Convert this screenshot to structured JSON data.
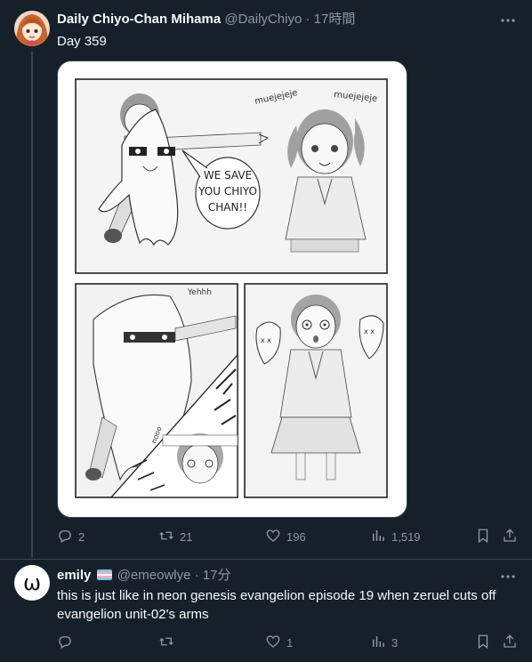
{
  "post1": {
    "display_name": "Daily Chiyo-Chan Mihama",
    "handle": "@DailyChiyo",
    "separator": "·",
    "time": "17時間",
    "text": "Day 359",
    "comic": {
      "sfx_left": "muejejeje",
      "sfx_right": "muejejeje",
      "speech": [
        "WE SAVE",
        "YOU CHIYO",
        "CHAN!!"
      ],
      "sfx_yehhh": "Yehhh",
      "sfx_nooo": "nooo"
    },
    "metrics": {
      "replies": "2",
      "retweets": "21",
      "likes": "196",
      "views": "1,519"
    }
  },
  "post2": {
    "display_name": "emily",
    "handle": "@emeowlye",
    "separator": "·",
    "time": "17分",
    "text_line1": "this is just like in neon genesis evangelion episode 19 when zeruel cuts off",
    "text_line2": "evangelion unit-02's arms",
    "avatar_glyph": "ω",
    "metrics": {
      "replies": "",
      "retweets": "",
      "likes": "1",
      "views": "3"
    }
  },
  "colors": {
    "background": "#15202b",
    "text_primary": "#f7f9f9",
    "text_secondary": "#8b98a5",
    "divider": "#38444d"
  },
  "icons": [
    "more-icon",
    "reply-icon",
    "retweet-icon",
    "like-icon",
    "views-icon",
    "bookmark-icon",
    "share-icon",
    "trans-flag-icon"
  ]
}
